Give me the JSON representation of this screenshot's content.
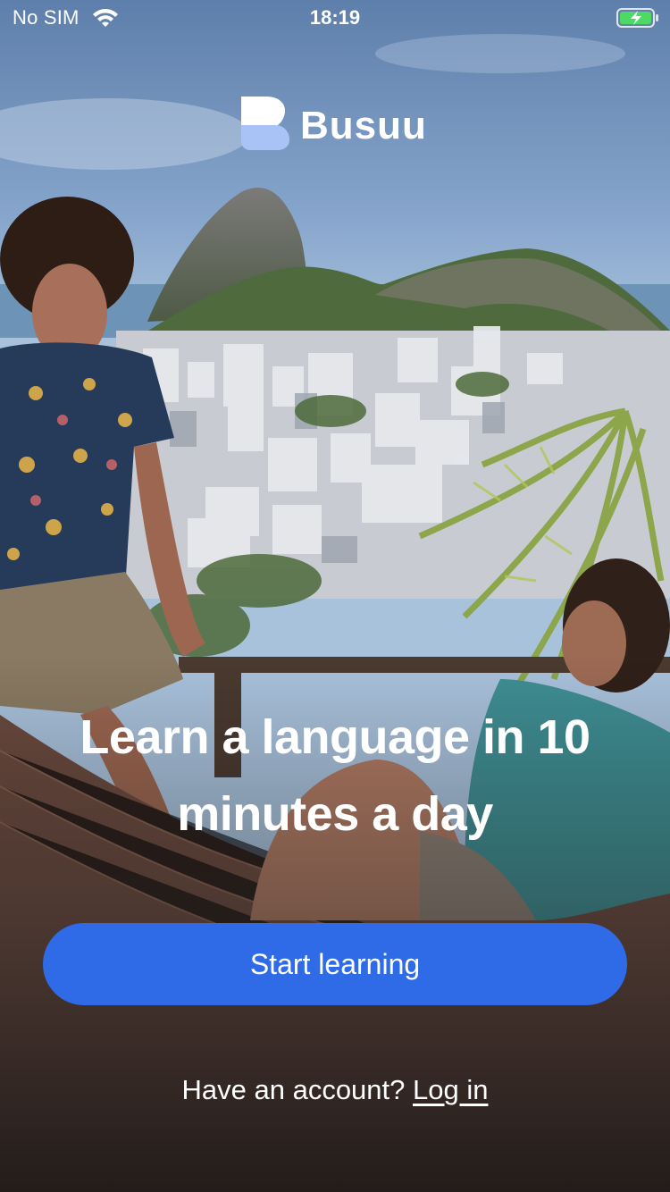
{
  "status_bar": {
    "carrier": "No SIM",
    "time": "18:19",
    "wifi_icon": "wifi-icon",
    "battery_icon": "battery-charging-icon",
    "battery_color": "#4cd964"
  },
  "brand": {
    "name": "Busuu",
    "logo_icon": "busuu-logo-icon"
  },
  "hero": {
    "headline_line1": "Learn a language in 10",
    "headline_line2": "minutes a day",
    "background": "photo of two people relaxing on a balcony overlooking Rio de Janeiro and Sugarloaf Mountain"
  },
  "actions": {
    "start_label": "Start learning",
    "account_prompt": "Have an account? ",
    "login_label": "Log in"
  },
  "colors": {
    "primary_button": "#2f6be6",
    "logo_light": "#ffffff",
    "logo_blue": "#a9c3f6",
    "text": "#ffffff"
  }
}
